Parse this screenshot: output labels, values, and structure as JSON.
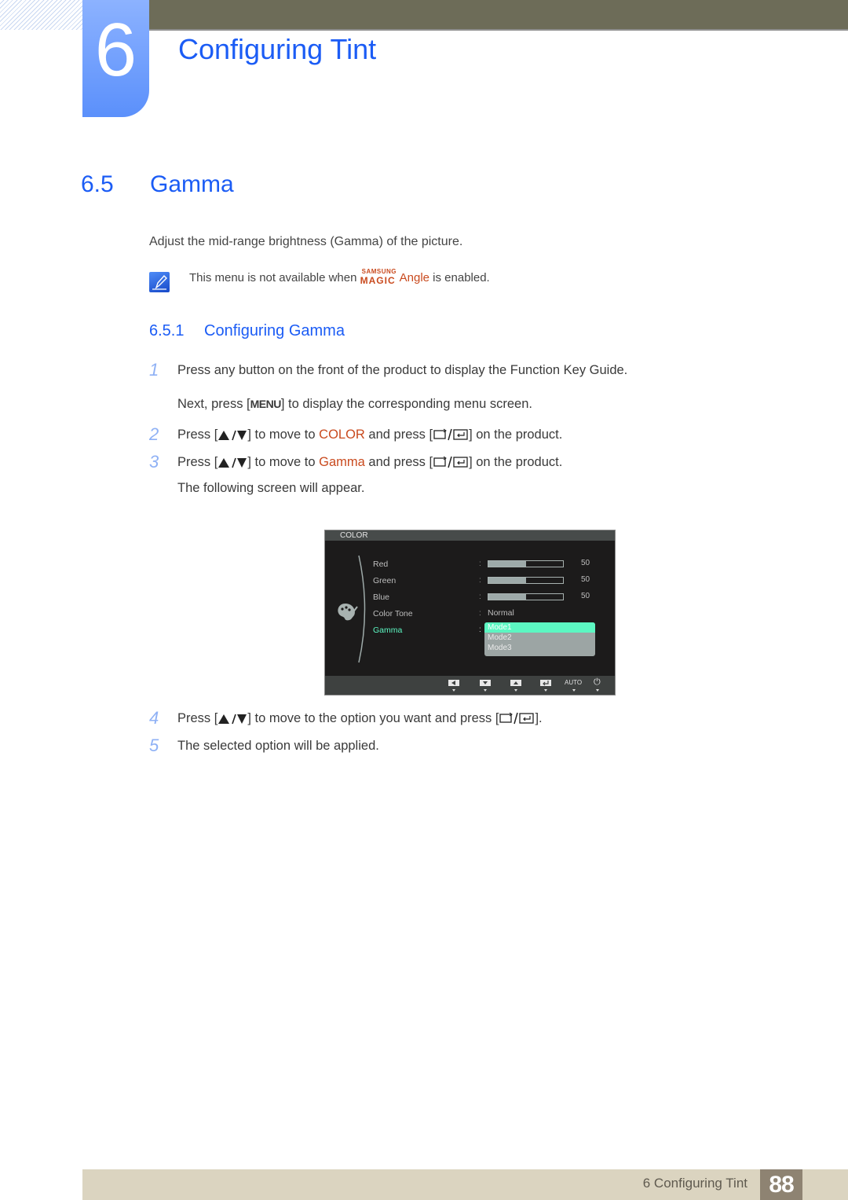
{
  "header": {
    "chapter_number": "6",
    "chapter_title": "Configuring Tint"
  },
  "section": {
    "number": "6.5",
    "title": "Gamma",
    "intro": "Adjust the mid-range brightness (Gamma) of the picture.",
    "note": {
      "icon": "note-pencil-icon",
      "text_before": "This menu is not available when ",
      "brand_small": "SAMSUNG",
      "brand_big": "MAGIC",
      "brand_suffix": "Angle",
      "text_after": " is enabled."
    }
  },
  "subsection": {
    "number": "6.5.1",
    "title": "Configuring Gamma"
  },
  "steps": [
    {
      "n": "1",
      "text": "Press any button on the front of the product to display the Function Key Guide."
    },
    {
      "n": "",
      "before": "Next, press [",
      "key": "MENU",
      "after": "] to display the corresponding menu screen."
    },
    {
      "n": "2",
      "before": "Press [",
      "mid": "] to move to ",
      "highlight": "COLOR",
      "mid2": " and press [",
      "after": "] on the product."
    },
    {
      "n": "3",
      "before": "Press [",
      "mid": "] to move to ",
      "highlight": "Gamma",
      "mid2": " and press [",
      "after": "] on the product."
    },
    {
      "n": "",
      "text": "The following screen will appear."
    },
    {
      "n": "4",
      "before": "Press [",
      "mid": "] to move to the option you want and press [",
      "after": "]."
    },
    {
      "n": "5",
      "text": "The selected option will be applied."
    }
  ],
  "osd": {
    "title": "COLOR",
    "icon": "palette-icon",
    "rows": [
      {
        "label": "Red",
        "type": "bar",
        "value": 50,
        "max": 100
      },
      {
        "label": "Green",
        "type": "bar",
        "value": 50,
        "max": 100
      },
      {
        "label": "Blue",
        "type": "bar",
        "value": 50,
        "max": 100
      },
      {
        "label": "Color Tone",
        "type": "text",
        "value": "Normal"
      },
      {
        "label": "Gamma",
        "type": "dropdown",
        "active": true
      }
    ],
    "gamma_options": [
      "Mode1",
      "Mode2",
      "Mode3"
    ],
    "gamma_selected": "Mode1",
    "footer_buttons": [
      "left-arrow-icon",
      "down-arrow-icon",
      "up-arrow-icon",
      "enter-icon",
      "AUTO",
      "power-icon"
    ],
    "auto_label": "AUTO",
    "colors": {
      "active": "#5cf7c2",
      "background": "#1c1b1b"
    }
  },
  "footer": {
    "label": "6 Configuring Tint",
    "page": "88"
  },
  "colors": {
    "heading_blue": "#1b5cf5",
    "highlight": "#c94a1e",
    "step_number": "#8fb1f5",
    "topbar": "#6d6c58",
    "footer_bg": "#dbd4c0",
    "page_badge": "#8e8372"
  }
}
